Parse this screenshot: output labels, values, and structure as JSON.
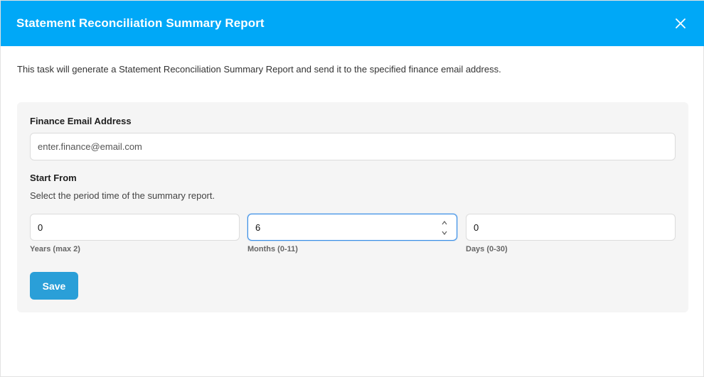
{
  "dialog": {
    "title": "Statement Reconciliation Summary Report",
    "description": "This task will generate a Statement Reconciliation Summary Report and send it to the specified finance email address."
  },
  "form": {
    "email_label": "Finance Email Address",
    "email_placeholder": "enter.finance@email.com",
    "start_label": "Start From",
    "start_help": "Select the period time of the summary report.",
    "fields": [
      {
        "value": "0",
        "caption": "Years (max 2)"
      },
      {
        "value": "6",
        "caption": "Months (0-11)"
      },
      {
        "value": "0",
        "caption": "Days (0-30)"
      }
    ],
    "save_label": "Save"
  },
  "colors": {
    "header_bg": "#00a8f7",
    "save_bg": "#2a9fd8",
    "focus_border": "#3a8ee6"
  }
}
